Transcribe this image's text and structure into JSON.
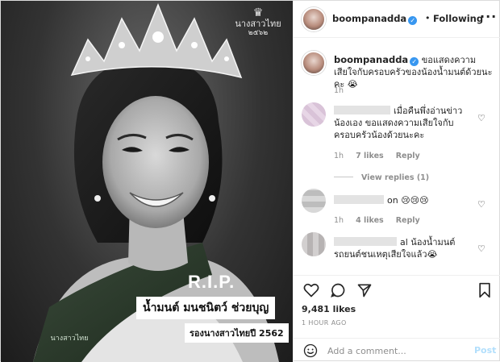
{
  "photo": {
    "logo_top": "นางสาวไทย",
    "logo_top_sub": "๒๕๖๒",
    "rip": "R.I.P.",
    "name": "น้ำมนต์ มนชนิตว์ ช่วยบุญ",
    "subtitle": "รองนางสาวไทยปี 2562",
    "logo_bottom": "นางสาวไทย"
  },
  "header": {
    "username": "boompanadda",
    "separator": "•",
    "follow_label": "Following",
    "more_icon": "more-horizontal-icon"
  },
  "caption": {
    "username": "boompanadda",
    "text": "ขอแสดงความเสียใจกับครอบครัวของน้องน้ำมนต์ด้วยนะคะ 😭",
    "time": "1h"
  },
  "comments": [
    {
      "text": "เมื่อคืนพึ่งอ่านข่าวน้องเอง ขอแสดงความเสียใจกับครอบครัวน้องด้วยนะคะ",
      "time": "1h",
      "likes": "7 likes",
      "reply": "Reply",
      "view_replies": "View replies (1)"
    },
    {
      "text_partial": "on",
      "emojis": "😢😢😢",
      "time": "1h",
      "likes": "4 likes",
      "reply": "Reply"
    },
    {
      "text_partial": "al",
      "text": "น้องน้ำมนต์รถยนต์ชนเหตุเสียใจแล้ว😭"
    }
  ],
  "footer": {
    "likes": "9,481 likes",
    "time_ago": "1 HOUR AGO",
    "comment_placeholder": "Add a comment...",
    "post_label": "Post"
  },
  "colors": {
    "verified": "#3897f0",
    "post_disabled": "#b2dffc",
    "meta_gray": "#8e8e8e"
  }
}
